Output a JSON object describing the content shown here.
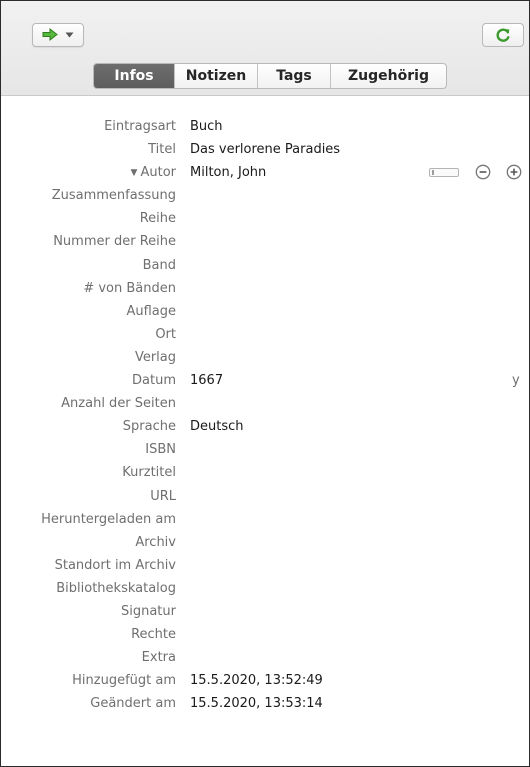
{
  "tabs": [
    {
      "label": "Infos",
      "active": true
    },
    {
      "label": "Notizen",
      "active": false
    },
    {
      "label": "Tags",
      "active": false
    },
    {
      "label": "Zugehörig",
      "active": false
    }
  ],
  "toolbar": {
    "locate_icon": "green-arrow-icon",
    "sync_icon": "sync-icon",
    "accent_green": "#3c9a2e"
  },
  "fields": [
    {
      "label": "Eintragsart",
      "value": "Buch"
    },
    {
      "label": "Titel",
      "value": "Das verlorene Paradies"
    },
    {
      "label": "Autor",
      "value": "Milton, John"
    },
    {
      "label": "Zusammenfassung",
      "value": ""
    },
    {
      "label": "Reihe",
      "value": ""
    },
    {
      "label": "Nummer der Reihe",
      "value": ""
    },
    {
      "label": "Band",
      "value": ""
    },
    {
      "label": "# von Bänden",
      "value": ""
    },
    {
      "label": "Auflage",
      "value": ""
    },
    {
      "label": "Ort",
      "value": ""
    },
    {
      "label": "Verlag",
      "value": ""
    },
    {
      "label": "Datum",
      "value": "1667"
    },
    {
      "label": "Anzahl der Seiten",
      "value": ""
    },
    {
      "label": "Sprache",
      "value": "Deutsch"
    },
    {
      "label": "ISBN",
      "value": ""
    },
    {
      "label": "Kurztitel",
      "value": ""
    },
    {
      "label": "URL",
      "value": ""
    },
    {
      "label": "Heruntergeladen am",
      "value": ""
    },
    {
      "label": "Archiv",
      "value": ""
    },
    {
      "label": "Standort im Archiv",
      "value": ""
    },
    {
      "label": "Bibliothekskatalog",
      "value": ""
    },
    {
      "label": "Signatur",
      "value": ""
    },
    {
      "label": "Rechte",
      "value": ""
    },
    {
      "label": "Extra",
      "value": ""
    },
    {
      "label": "Hinzugefügt am",
      "value": "15.5.2020, 13:52:49"
    },
    {
      "label": "Geändert am",
      "value": "15.5.2020, 13:53:14"
    }
  ],
  "date_hint": "y"
}
